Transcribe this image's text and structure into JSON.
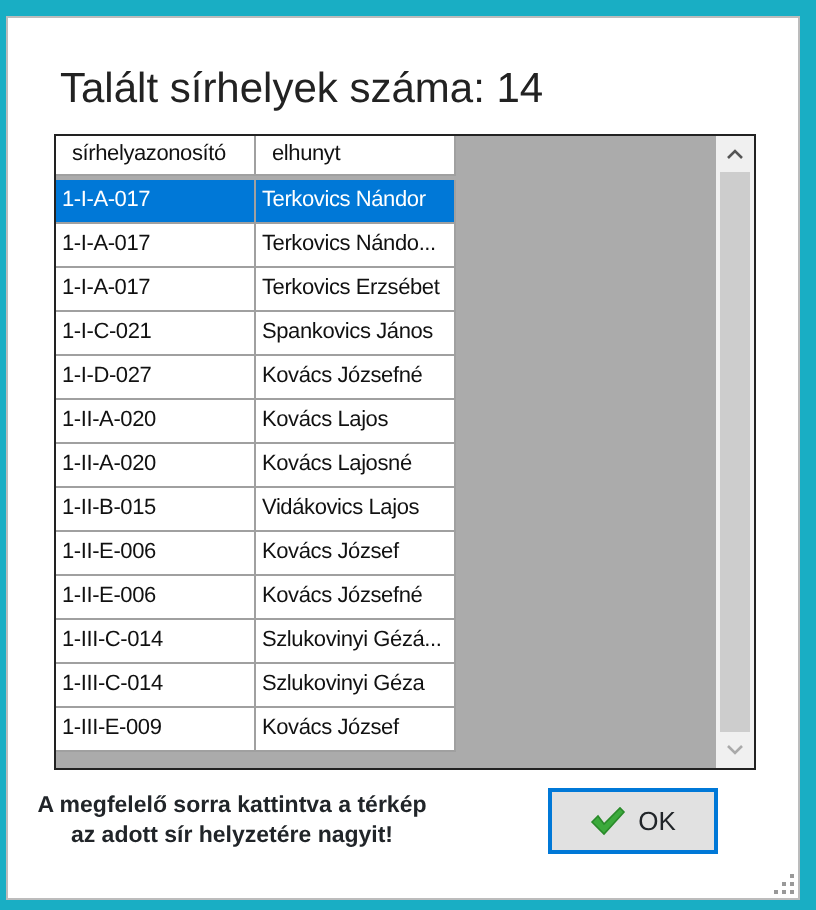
{
  "dialog": {
    "title": "Talált sírhelyek száma: 14"
  },
  "table": {
    "columns": [
      "sírhelyazonosító",
      "elhunyt"
    ],
    "rows": [
      {
        "cells": [
          "1-I-A-017",
          "Terkovics Nándor"
        ],
        "selected": true
      },
      {
        "cells": [
          "1-I-A-017",
          "Terkovics Nándo..."
        ],
        "selected": false
      },
      {
        "cells": [
          "1-I-A-017",
          "Terkovics Erzsébet"
        ],
        "selected": false
      },
      {
        "cells": [
          "1-I-C-021",
          "Spankovics János"
        ],
        "selected": false
      },
      {
        "cells": [
          "1-I-D-027",
          "Kovács Józsefné"
        ],
        "selected": false
      },
      {
        "cells": [
          "1-II-A-020",
          "Kovács Lajos"
        ],
        "selected": false
      },
      {
        "cells": [
          "1-II-A-020",
          "Kovács Lajosné"
        ],
        "selected": false
      },
      {
        "cells": [
          "1-II-B-015",
          "Vidákovics Lajos"
        ],
        "selected": false
      },
      {
        "cells": [
          "1-II-E-006",
          "Kovács József"
        ],
        "selected": false
      },
      {
        "cells": [
          "1-II-E-006",
          "Kovács Józsefné"
        ],
        "selected": false
      },
      {
        "cells": [
          "1-III-C-014",
          "Szlukovinyi Gézá..."
        ],
        "selected": false
      },
      {
        "cells": [
          "1-III-C-014",
          "Szlukovinyi Géza"
        ],
        "selected": false
      },
      {
        "cells": [
          "1-III-E-009",
          "Kovács József"
        ],
        "selected": false
      }
    ]
  },
  "hint": "A megfelelő sorra kattintva a térkép az adott sír helyzetére nagyit!",
  "ok_button": "OK"
}
